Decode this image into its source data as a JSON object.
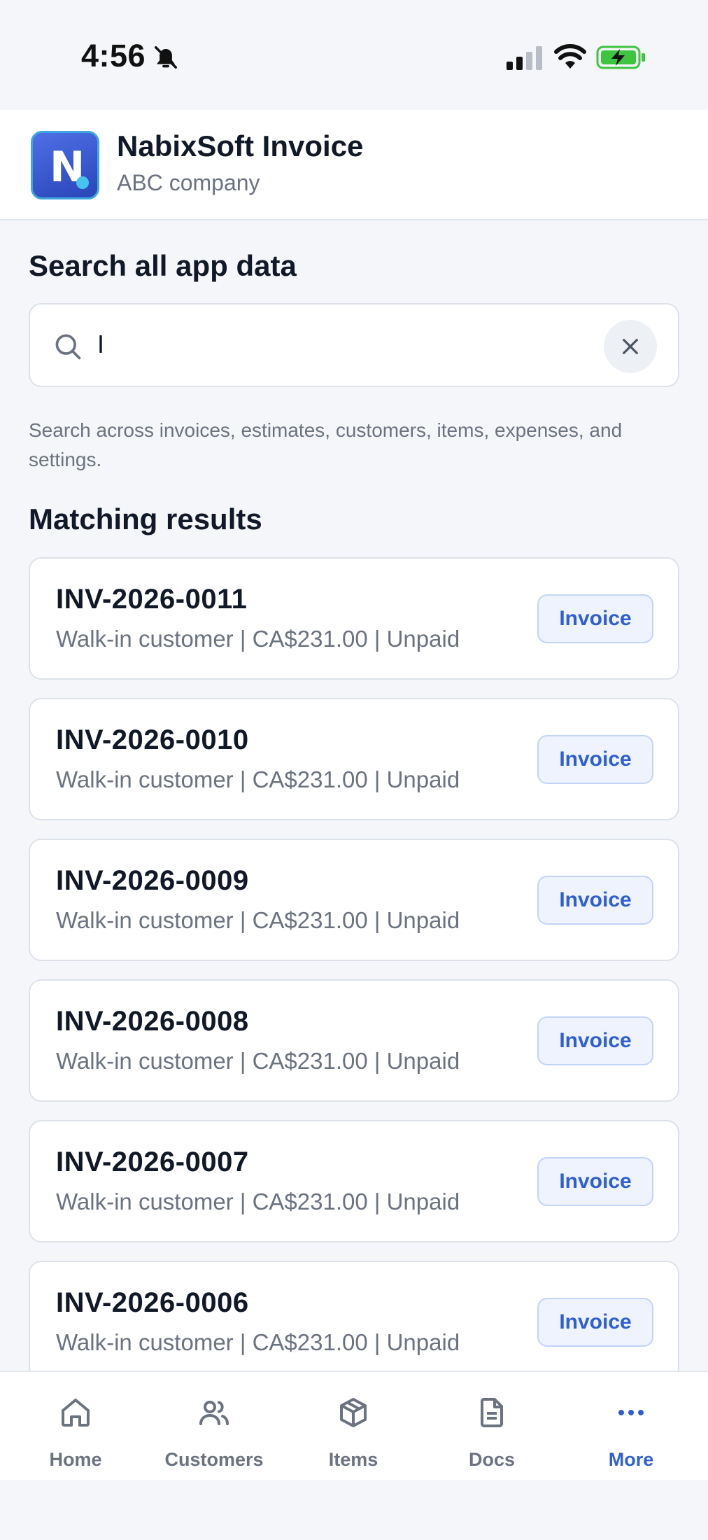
{
  "status_bar": {
    "time": "4:56",
    "icons": [
      "bell-slash-icon",
      "cellular-signal-icon",
      "wifi-icon",
      "battery-charging-icon"
    ]
  },
  "app": {
    "logo_letter": "N",
    "title": "NabixSoft Invoice",
    "subtitle": "ABC company"
  },
  "search": {
    "heading": "Search all app data",
    "value": "I",
    "help_text": "Search across invoices, estimates, customers, items, expenses, and settings."
  },
  "results": {
    "heading": "Matching results",
    "items": [
      {
        "title": "INV-2026-0011",
        "meta": "Walk-in customer | CA$231.00 | Unpaid",
        "type": "Invoice"
      },
      {
        "title": "INV-2026-0010",
        "meta": "Walk-in customer | CA$231.00 | Unpaid",
        "type": "Invoice"
      },
      {
        "title": "INV-2026-0009",
        "meta": "Walk-in customer | CA$231.00 | Unpaid",
        "type": "Invoice"
      },
      {
        "title": "INV-2026-0008",
        "meta": "Walk-in customer | CA$231.00 | Unpaid",
        "type": "Invoice"
      },
      {
        "title": "INV-2026-0007",
        "meta": "Walk-in customer | CA$231.00 | Unpaid",
        "type": "Invoice"
      },
      {
        "title": "INV-2026-0006",
        "meta": "Walk-in customer | CA$231.00 | Unpaid",
        "type": "Invoice"
      }
    ]
  },
  "nav": {
    "items": [
      {
        "label": "Home",
        "icon": "home-icon"
      },
      {
        "label": "Customers",
        "icon": "users-icon"
      },
      {
        "label": "Items",
        "icon": "box-icon"
      },
      {
        "label": "Docs",
        "icon": "document-icon"
      },
      {
        "label": "More",
        "icon": "more-icon",
        "active": true
      }
    ]
  },
  "colors": {
    "accent": "#2f5fd0",
    "background": "#f4f6f9",
    "text_primary": "#111827",
    "text_secondary": "#6b7280",
    "battery_green": "#3fc43f"
  }
}
